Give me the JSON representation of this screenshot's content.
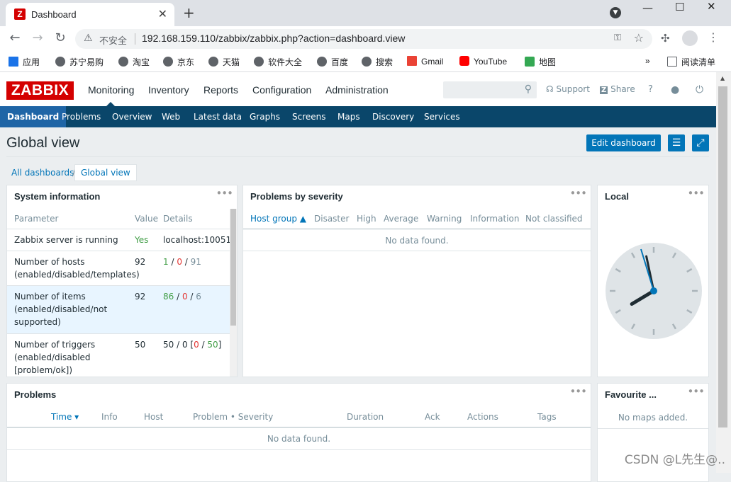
{
  "browser": {
    "tab_title": "Dashboard",
    "tab_icon": "Z",
    "insecure_label": "不安全",
    "url": "192.168.159.110/zabbix/zabbix.php?action=dashboard.view",
    "bookmarks": [
      "应用",
      "苏宁易购",
      "淘宝",
      "京东",
      "天猫",
      "软件大全",
      "百度",
      "搜索",
      "Gmail",
      "YouTube",
      "地图"
    ],
    "more_label": "»",
    "reading_list": "阅读清单"
  },
  "header": {
    "logo": "ZABBIX",
    "menu": [
      "Monitoring",
      "Inventory",
      "Reports",
      "Configuration",
      "Administration"
    ],
    "support": "Support",
    "share": "Share",
    "help": "?"
  },
  "submenu": [
    "Dashboard",
    "Problems",
    "Overview",
    "Web",
    "Latest data",
    "Graphs",
    "Screens",
    "Maps",
    "Discovery",
    "Services"
  ],
  "page": {
    "title": "Global view",
    "edit_button": "Edit dashboard",
    "breadcrumb_all": "All dashboards",
    "breadcrumb_sep": "/",
    "breadcrumb_current": "Global view"
  },
  "system_info": {
    "title": "System information",
    "columns": [
      "Parameter",
      "Value",
      "Details"
    ],
    "rows": [
      {
        "param": "Zabbix server is running",
        "value": "Yes",
        "details": "localhost:10051"
      },
      {
        "param": "Number of hosts (enabled/disabled/templates)",
        "value": "92",
        "d1": "1",
        "d2": "0",
        "d3": "91"
      },
      {
        "param": "Number of items (enabled/disabled/not supported)",
        "value": "92",
        "d1": "86",
        "d2": "0",
        "d3": "6"
      },
      {
        "param": "Number of triggers (enabled/disabled [problem/ok])",
        "value": "50",
        "d_pre": "50 / 0 [",
        "d1": "0",
        "d2": "50",
        "d_post": "]"
      }
    ]
  },
  "severity": {
    "title": "Problems by severity",
    "columns": [
      "Host group ▲",
      "Disaster",
      "High",
      "Average",
      "Warning",
      "Information",
      "Not classified"
    ],
    "empty": "No data found."
  },
  "clock": {
    "title": "Local",
    "time": {
      "hour": 7,
      "minute": 58
    }
  },
  "problems": {
    "title": "Problems",
    "columns": [
      "Time ▾",
      "Info",
      "Host",
      "Problem • Severity",
      "Duration",
      "Ack",
      "Actions",
      "Tags"
    ],
    "empty": "No data found."
  },
  "favourite": {
    "title": "Favourite ...",
    "empty": "No maps added."
  },
  "watermark": "CSDN @L先生@.."
}
